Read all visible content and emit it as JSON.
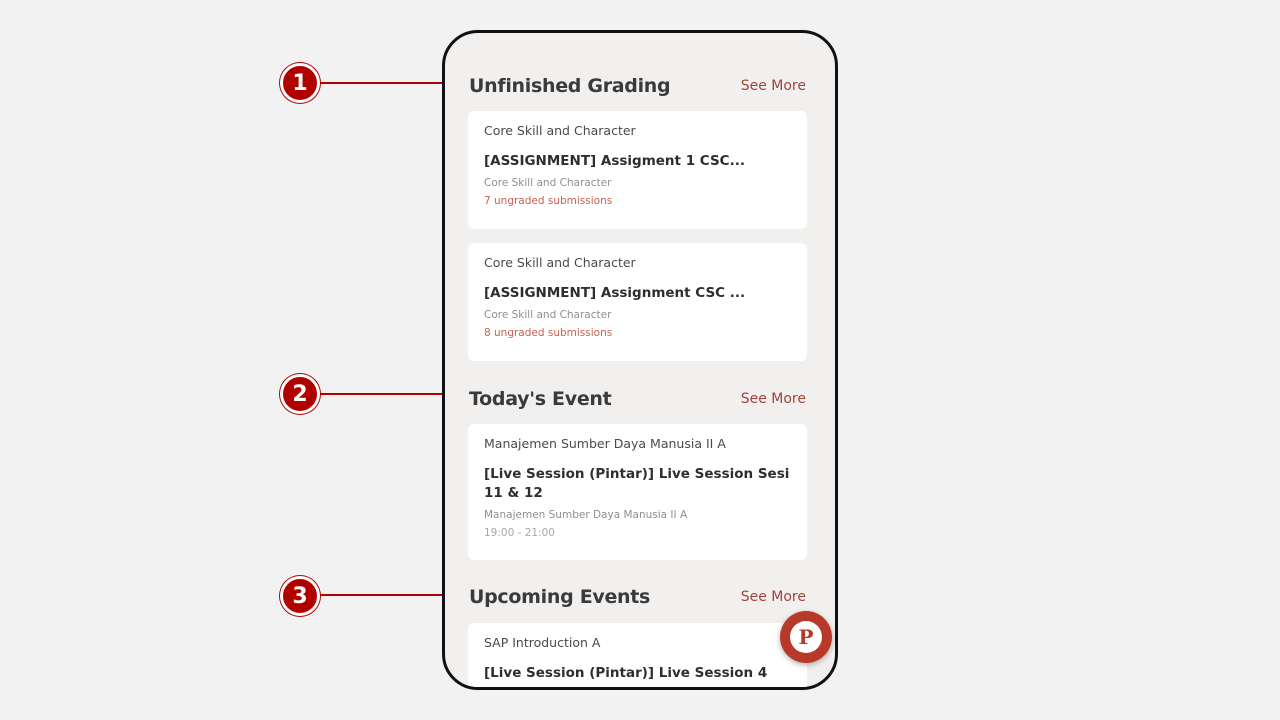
{
  "callouts": [
    {
      "number": "1"
    },
    {
      "number": "2"
    },
    {
      "number": "3"
    }
  ],
  "unfinished_grading": {
    "title": "Unfinished Grading",
    "see_more": "See More",
    "cards": [
      {
        "course": "Core Skill and Character",
        "title": "[ASSIGNMENT] Assigment 1 CSC...",
        "subtitle": "Core Skill and Character",
        "status": "7 ungraded submissions"
      },
      {
        "course": "Core Skill and Character",
        "title": "[ASSIGNMENT] Assignment CSC ...",
        "subtitle": "Core Skill and Character",
        "status": "8 ungraded submissions"
      }
    ]
  },
  "todays_event": {
    "title": "Today's Event",
    "see_more": "See More",
    "cards": [
      {
        "course": "Manajemen Sumber Daya Manusia II A",
        "title": "[Live Session (Pintar)] Live Session Sesi 11 & 12",
        "subtitle": "Manajemen Sumber Daya Manusia II A",
        "time": "19:00 - 21:00"
      }
    ]
  },
  "upcoming_events": {
    "title": "Upcoming Events",
    "see_more": "See More",
    "cards": [
      {
        "course": "SAP Introduction A",
        "title": "[Live Session (Pintar)] Live Session 4"
      }
    ]
  },
  "fab": {
    "icon": "p-logo-icon",
    "label": "P"
  },
  "colors": {
    "accent": "#a0433a",
    "callout": "#b00000",
    "fab": "#b8392a"
  }
}
